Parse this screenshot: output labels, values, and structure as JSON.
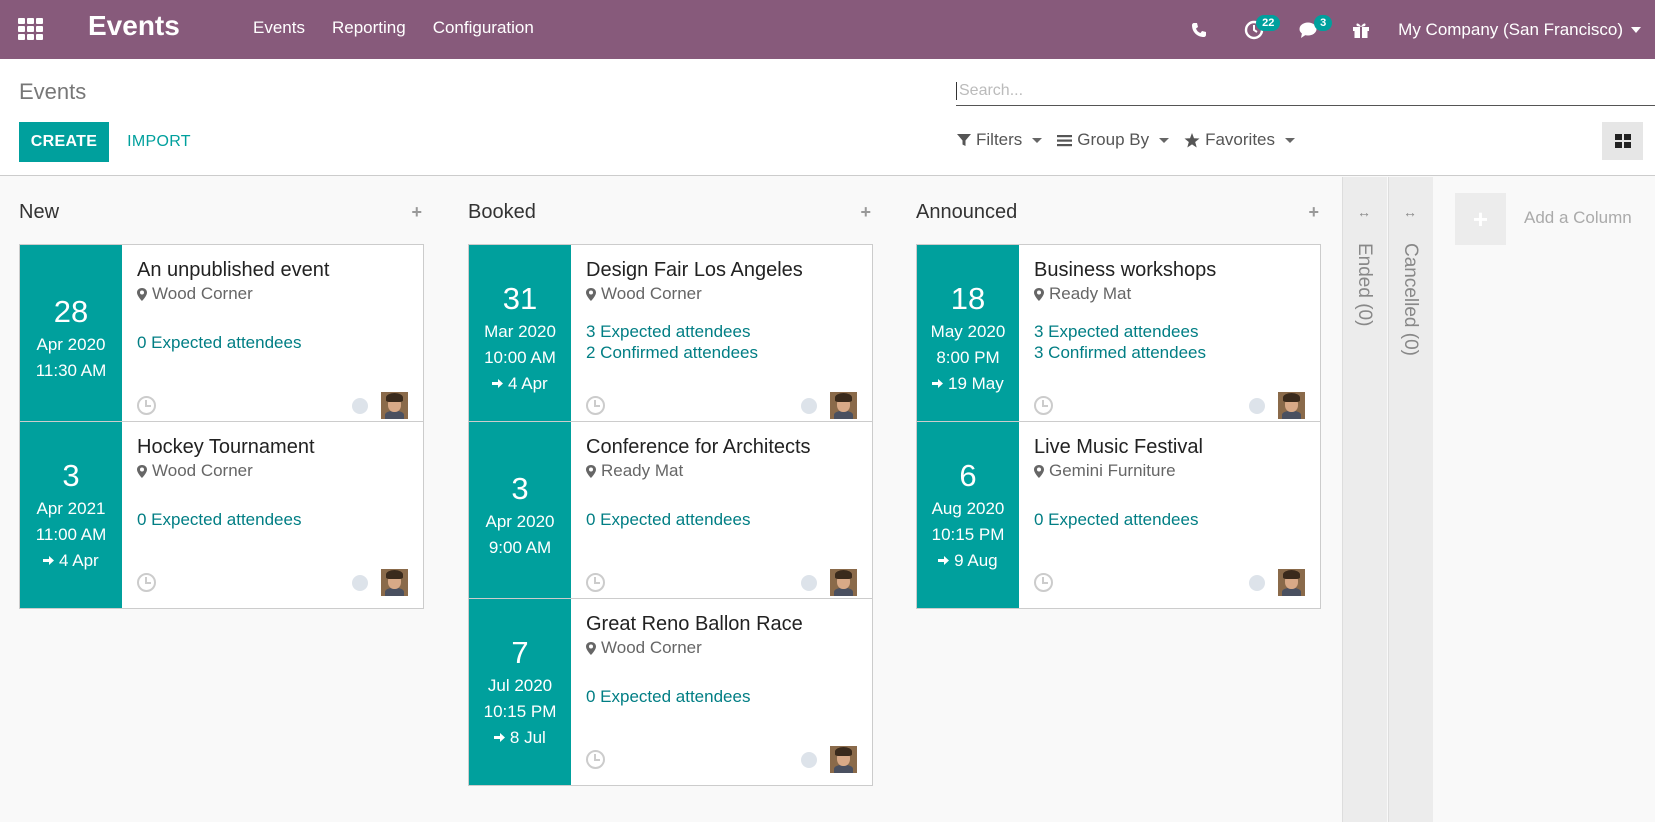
{
  "navbar": {
    "brand": "Events",
    "menu": [
      "Events",
      "Reporting",
      "Configuration"
    ],
    "activity_count": "22",
    "messages_count": "3",
    "company": "My Company (San Francisco)"
  },
  "control": {
    "breadcrumb": "Events",
    "search_placeholder": "Search...",
    "create_label": "CREATE",
    "import_label": "IMPORT",
    "filters_label": "Filters",
    "groupby_label": "Group By",
    "favorites_label": "Favorites"
  },
  "columns": [
    {
      "title": "New",
      "cards": [
        {
          "day": "28",
          "month": "Apr 2020",
          "time": "11:30 AM",
          "end": "",
          "name": "An unpublished event",
          "place": "Wood Corner",
          "attendees": [
            "0 Expected attendees"
          ]
        },
        {
          "day": "3",
          "month": "Apr 2021",
          "time": "11:00 AM",
          "end": "4 Apr",
          "name": "Hockey Tournament",
          "place": "Wood Corner",
          "attendees": [
            "0 Expected attendees"
          ]
        }
      ]
    },
    {
      "title": "Booked",
      "cards": [
        {
          "day": "31",
          "month": "Mar 2020",
          "time": "10:00 AM",
          "end": "4 Apr",
          "name": "Design Fair Los Angeles",
          "place": "Wood Corner",
          "attendees": [
            "3 Expected attendees",
            "2 Confirmed attendees"
          ]
        },
        {
          "day": "3",
          "month": "Apr 2020",
          "time": "9:00 AM",
          "end": "",
          "name": "Conference for Architects",
          "place": "Ready Mat",
          "attendees": [
            "0 Expected attendees"
          ]
        },
        {
          "day": "7",
          "month": "Jul 2020",
          "time": "10:15 PM",
          "end": "8 Jul",
          "name": "Great Reno Ballon Race",
          "place": "Wood Corner",
          "attendees": [
            "0 Expected attendees"
          ]
        }
      ]
    },
    {
      "title": "Announced",
      "cards": [
        {
          "day": "18",
          "month": "May 2020",
          "time": "8:00 PM",
          "end": "19 May",
          "name": "Business workshops",
          "place": "Ready Mat",
          "attendees": [
            "3 Expected attendees",
            "3 Confirmed attendees"
          ]
        },
        {
          "day": "6",
          "month": "Aug 2020",
          "time": "10:15 PM",
          "end": "9 Aug",
          "name": "Live Music Festival",
          "place": "Gemini Furniture",
          "attendees": [
            "0 Expected attendees"
          ]
        }
      ]
    }
  ],
  "folded": [
    "Ended (0)",
    "Cancelled (0)"
  ],
  "add_column_label": "Add a Column",
  "colors": {
    "navbar": "#875a7b",
    "accent": "#00a09d",
    "link": "#017e84"
  }
}
